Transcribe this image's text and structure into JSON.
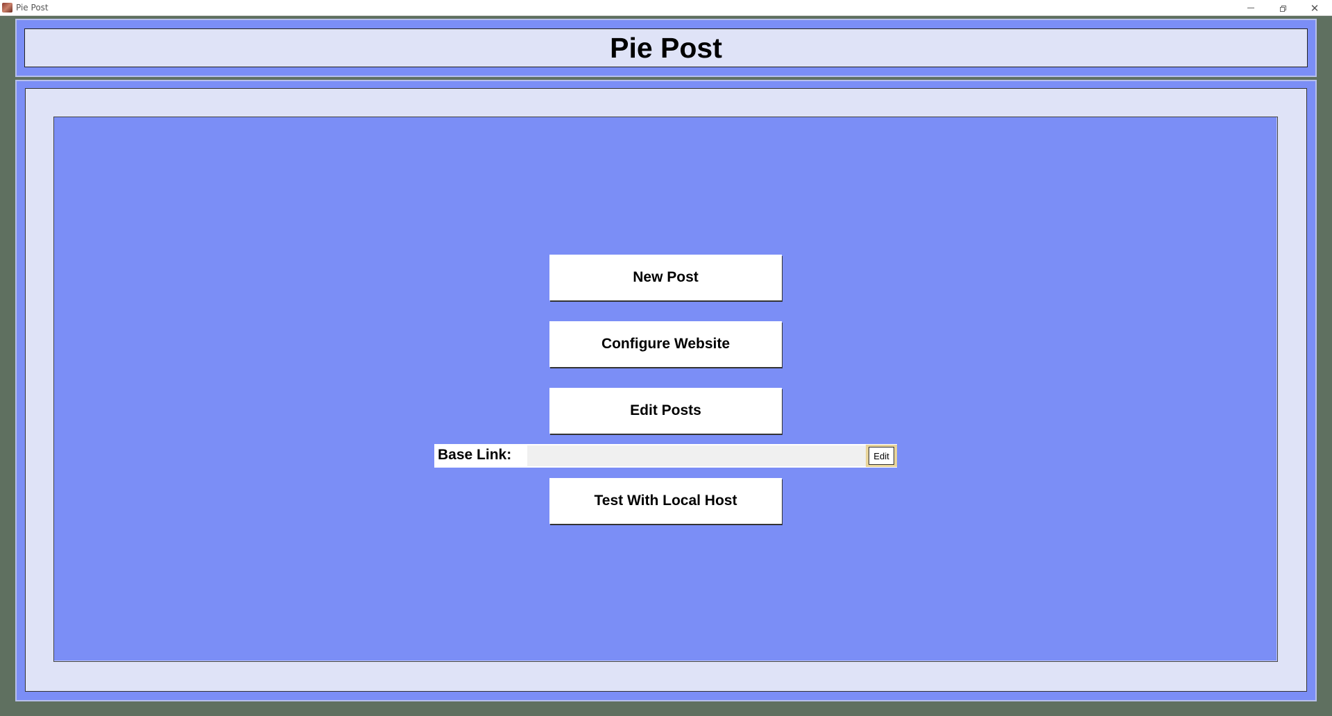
{
  "window": {
    "title": "Pie Post",
    "icon": "pie-app-icon",
    "controls": [
      "minimize-icon",
      "restore-icon",
      "close-icon"
    ]
  },
  "header": {
    "title": "Pie Post"
  },
  "main": {
    "buttons": {
      "new_post": "New Post",
      "configure_website": "Configure Website",
      "edit_posts": "Edit Posts",
      "test_local_host": "Test With Local Host"
    },
    "base_link": {
      "label": "Base Link:",
      "value": "",
      "edit_label": "Edit"
    }
  },
  "colors": {
    "background": "#5f7060",
    "panel_blue": "#7b8ef6",
    "panel_light": "#dfe3f7",
    "button_bg": "#ffffff",
    "edit_accent": "#e8d49a"
  }
}
